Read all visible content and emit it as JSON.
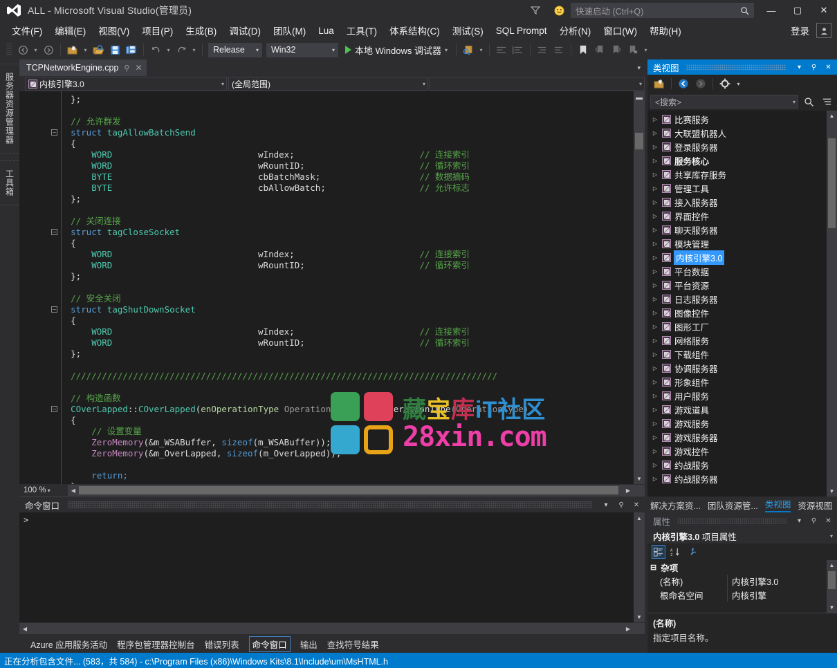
{
  "window": {
    "title": "ALL - Microsoft Visual Studio(管理员)",
    "minimize": "—",
    "maximize": "▢",
    "close": "✕"
  },
  "quick_launch": {
    "placeholder": "快速启动 (Ctrl+Q)",
    "icon": "search-icon"
  },
  "title_icons": {
    "filter": "filter-icon",
    "feedback": "smiley-icon"
  },
  "menu": {
    "items": [
      "文件(F)",
      "编辑(E)",
      "视图(V)",
      "项目(P)",
      "生成(B)",
      "调试(D)",
      "团队(M)",
      "Lua",
      "工具(T)",
      "体系结构(C)",
      "测试(S)",
      "SQL Prompt",
      "分析(N)",
      "窗口(W)",
      "帮助(H)"
    ],
    "signin": "登录"
  },
  "toolbar": {
    "configuration": "Release",
    "platform": "Win32",
    "debug_target": "本地 Windows 调试器"
  },
  "left_strip": {
    "tabs": [
      "服务器资源管理器",
      "工具箱"
    ]
  },
  "document_tab": {
    "name": "TCPNetworkEngine.cpp",
    "pin": "⚲",
    "close": "✕"
  },
  "nav_bar": {
    "project": "内核引擎3.0",
    "scope": "(全局范围)",
    "member": ""
  },
  "editor": {
    "zoom": "100 %",
    "lines": [
      [
        {
          "t": "    };",
          "c": "id"
        }
      ],
      [],
      [
        {
          "t": "    // 允许群发",
          "c": "cmt"
        }
      ],
      [
        {
          "t": "    struct ",
          "c": "kw"
        },
        {
          "t": "tagAllowBatchSend",
          "c": "typ"
        }
      ],
      [
        {
          "t": "    {",
          "c": "id"
        }
      ],
      [
        {
          "t": "        WORD",
          "c": "typ"
        },
        {
          "t": "                            wIndex;",
          "c": "id"
        },
        {
          "t": "                        // 连接索引",
          "c": "cmt"
        }
      ],
      [
        {
          "t": "        WORD",
          "c": "typ"
        },
        {
          "t": "                            wRountID;",
          "c": "id"
        },
        {
          "t": "                      // 循环索引",
          "c": "cmt"
        }
      ],
      [
        {
          "t": "        BYTE",
          "c": "typ"
        },
        {
          "t": "                            cbBatchMask;",
          "c": "id"
        },
        {
          "t": "                   // 数据摘码",
          "c": "cmt"
        }
      ],
      [
        {
          "t": "        BYTE",
          "c": "typ"
        },
        {
          "t": "                            cbAllowBatch;",
          "c": "id"
        },
        {
          "t": "                  // 允许标志",
          "c": "cmt"
        }
      ],
      [
        {
          "t": "    };",
          "c": "id"
        }
      ],
      [],
      [
        {
          "t": "    // 关闭连接",
          "c": "cmt"
        }
      ],
      [
        {
          "t": "    struct ",
          "c": "kw"
        },
        {
          "t": "tagCloseSocket",
          "c": "typ"
        }
      ],
      [
        {
          "t": "    {",
          "c": "id"
        }
      ],
      [
        {
          "t": "        WORD",
          "c": "typ"
        },
        {
          "t": "                            wIndex;",
          "c": "id"
        },
        {
          "t": "                        // 连接索引",
          "c": "cmt"
        }
      ],
      [
        {
          "t": "        WORD",
          "c": "typ"
        },
        {
          "t": "                            wRountID;",
          "c": "id"
        },
        {
          "t": "                      // 循环索引",
          "c": "cmt"
        }
      ],
      [
        {
          "t": "    };",
          "c": "id"
        }
      ],
      [],
      [
        {
          "t": "    // 安全关闭",
          "c": "cmt"
        }
      ],
      [
        {
          "t": "    struct ",
          "c": "kw"
        },
        {
          "t": "tagShutDownSocket",
          "c": "typ"
        }
      ],
      [
        {
          "t": "    {",
          "c": "id"
        }
      ],
      [
        {
          "t": "        WORD",
          "c": "typ"
        },
        {
          "t": "                            wIndex;",
          "c": "id"
        },
        {
          "t": "                        // 连接索引",
          "c": "cmt"
        }
      ],
      [
        {
          "t": "        WORD",
          "c": "typ"
        },
        {
          "t": "                            wRountID;",
          "c": "id"
        },
        {
          "t": "                      // 循环索引",
          "c": "cmt"
        }
      ],
      [
        {
          "t": "    };",
          "c": "id"
        }
      ],
      [],
      [
        {
          "t": "    //////////////////////////////////////////////////////////////////////////////////",
          "c": "cmt"
        }
      ],
      [],
      [
        {
          "t": "    // 构造函数",
          "c": "cmt"
        }
      ],
      [
        {
          "t": "    COverLapped",
          "c": "typ"
        },
        {
          "t": "::",
          "c": "id"
        },
        {
          "t": "COverLapped",
          "c": "typ"
        },
        {
          "t": "(",
          "c": "id"
        },
        {
          "t": "enOperationType",
          "c": "en"
        },
        {
          "t": " OperationType) : ",
          "c": "par"
        },
        {
          "t": "m_OperationType",
          "c": "id"
        },
        {
          "t": "(OperationType)",
          "c": "par"
        }
      ],
      [
        {
          "t": "    {",
          "c": "id"
        }
      ],
      [
        {
          "t": "        // 设置变量",
          "c": "cmt"
        }
      ],
      [
        {
          "t": "        ZeroMemory",
          "c": "fn"
        },
        {
          "t": "(&m_WSABuffer, ",
          "c": "id"
        },
        {
          "t": "sizeof",
          "c": "kw"
        },
        {
          "t": "(m_WSABuffer));",
          "c": "id"
        }
      ],
      [
        {
          "t": "        ZeroMemory",
          "c": "fn"
        },
        {
          "t": "(&m_OverLapped, ",
          "c": "id"
        },
        {
          "t": "sizeof",
          "c": "kw"
        },
        {
          "t": "(m_OverLapped));",
          "c": "id"
        }
      ],
      [],
      [
        {
          "t": "        return;",
          "c": "kw"
        }
      ],
      [
        {
          "t": "    }",
          "c": "id"
        }
      ]
    ]
  },
  "watermark": {
    "brand_cn": "藏宝库iT社区",
    "domain": "28xin.com",
    "colors": {
      "green": "#3aa055",
      "red": "#e0415a",
      "blue": "#35a8d0",
      "yellow": "#e8a317",
      "magenta": "#ee3fa8"
    }
  },
  "command_window": {
    "title": "命令窗口",
    "prompt": ">",
    "buttons": {
      "menu": "▾",
      "close": "✕"
    }
  },
  "bottom_tabs": {
    "items": [
      "Azure 应用服务活动",
      "程序包管理器控制台",
      "错误列表",
      "命令窗口",
      "输出",
      "查找符号结果"
    ],
    "active": "命令窗口"
  },
  "class_view": {
    "title": "类视图",
    "search_placeholder": "<搜索>",
    "toolbar_icons": [
      "new-folder-icon",
      "back-icon",
      "forward-icon",
      "gear-icon",
      "chevron-down-icon"
    ],
    "search_icons": [
      "search-icon",
      "sort-icon"
    ],
    "items": [
      {
        "label": "比赛服务",
        "bold": false
      },
      {
        "label": "大联盟机器人",
        "bold": false
      },
      {
        "label": "登录服务器",
        "bold": false
      },
      {
        "label": "服务核心",
        "bold": true
      },
      {
        "label": "共享库存服务",
        "bold": false
      },
      {
        "label": "管理工具",
        "bold": false
      },
      {
        "label": "接入服务器",
        "bold": false
      },
      {
        "label": "界面控件",
        "bold": false
      },
      {
        "label": "聊天服务器",
        "bold": false
      },
      {
        "label": "模块管理",
        "bold": false
      },
      {
        "label": "内核引擎3.0",
        "bold": false,
        "selected": true
      },
      {
        "label": "平台数据",
        "bold": false
      },
      {
        "label": "平台资源",
        "bold": false
      },
      {
        "label": "日志服务器",
        "bold": false
      },
      {
        "label": "图像控件",
        "bold": false
      },
      {
        "label": "图形工厂",
        "bold": false
      },
      {
        "label": "网络服务",
        "bold": false
      },
      {
        "label": "下载组件",
        "bold": false
      },
      {
        "label": "协调服务器",
        "bold": false
      },
      {
        "label": "形象组件",
        "bold": false
      },
      {
        "label": "用户服务",
        "bold": false
      },
      {
        "label": "游戏道具",
        "bold": false
      },
      {
        "label": "游戏服务",
        "bold": false
      },
      {
        "label": "游戏服务器",
        "bold": false
      },
      {
        "label": "游戏控件",
        "bold": false
      },
      {
        "label": "约战服务",
        "bold": false
      },
      {
        "label": "约战服务器",
        "bold": false
      }
    ],
    "dock_tabs": [
      "解决方案资...",
      "团队资源管...",
      "类视图",
      "资源视图"
    ],
    "dock_tab_active": "类视图"
  },
  "properties": {
    "title": "属性",
    "object_name": "内核引擎3.0",
    "object_suffix": " 项目属性",
    "toolbar_icons": [
      "categorized-icon",
      "alphabetical-icon",
      "property-pages-icon"
    ],
    "category": "杂项",
    "rows": [
      {
        "name": "(名称)",
        "value": "内核引擎3.0"
      },
      {
        "name": "根命名空间",
        "value": "内核引擎"
      }
    ],
    "desc_title": "(名称)",
    "desc_body": "指定项目名称。"
  },
  "status_bar": {
    "text": "正在分析包含文件... (583，共 584) - c:\\Program Files (x86)\\Windows Kits\\8.1\\Include\\um\\MsHTML.h",
    "color": "#007acc"
  }
}
